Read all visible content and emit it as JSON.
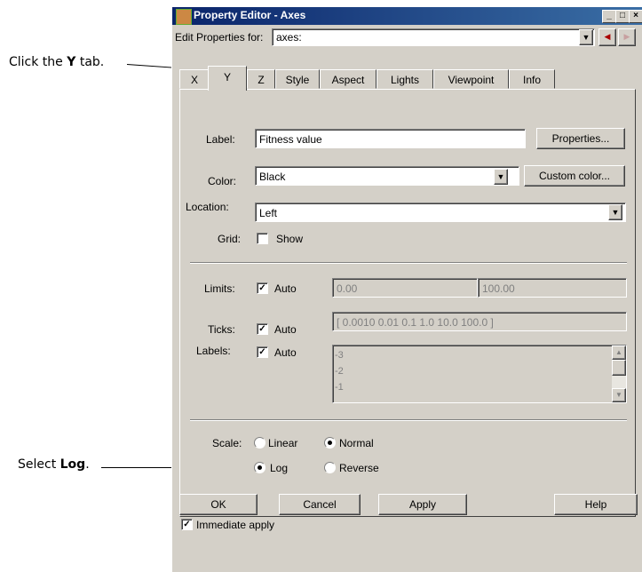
{
  "callouts": {
    "y_tab_prefix": "Click the ",
    "y_tab_bold": "Y",
    "y_tab_suffix": " tab.",
    "log_prefix": "Select ",
    "log_bold": "Log",
    "log_suffix": "."
  },
  "window": {
    "title": "Property Editor - Axes",
    "minimize": "_",
    "maximize": "□",
    "close": "×"
  },
  "edit_for": {
    "label": "Edit Properties for:",
    "value": "axes:"
  },
  "tabs": [
    "X",
    "Y",
    "Z",
    "Style",
    "Aspect",
    "Lights",
    "Viewpoint",
    "Info"
  ],
  "active_tab": "Y",
  "form": {
    "label_label": "Label:",
    "label_value": "Fitness value",
    "properties_button": "Properties...",
    "color_label": "Color:",
    "color_value": "Black",
    "custom_color_button": "Custom color...",
    "location_label": "Location:",
    "location_value": "Left",
    "grid_label": "Grid:",
    "grid_show": "Show",
    "limits_label": "Limits:",
    "limits_auto": "Auto",
    "limits_min": "0.00",
    "limits_max": "100.00",
    "ticks_label": "Ticks:",
    "ticks_auto": "Auto",
    "ticks_value": "[ 0.0010 0.01 0.1 1.0 10.0 100.0 ]",
    "labels_label": "Labels:",
    "labels_auto": "Auto",
    "labels_list": [
      "-3",
      "-2",
      "-1"
    ],
    "scale_label": "Scale:",
    "scale_linear": "Linear",
    "scale_log": "Log",
    "dir_normal": "Normal",
    "dir_reverse": "Reverse"
  },
  "buttons": {
    "ok": "OK",
    "cancel": "Cancel",
    "apply": "Apply",
    "help": "Help"
  },
  "immediate_apply": "Immediate apply",
  "state": {
    "grid_show": false,
    "limits_auto": true,
    "ticks_auto": true,
    "labels_auto": true,
    "scale": "Log",
    "direction": "Normal",
    "immediate_apply": true
  }
}
